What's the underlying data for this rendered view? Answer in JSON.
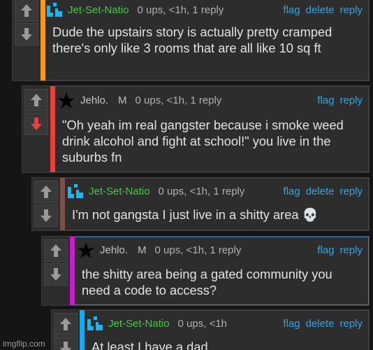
{
  "actions": {
    "flag": "flag",
    "delete": "delete",
    "reply": "reply"
  },
  "colors": {
    "orange": "#f39a1c",
    "red": "#e8403a",
    "brown": "#7e5148",
    "magenta": "#c41fc9",
    "blue": "#17a8f0"
  },
  "comments": [
    {
      "user": "Jet-Set-Natio",
      "meta": "0 ups, <1h, 1 reply",
      "text": "Dude the upstairs story is actually pretty cramped there's only like 3 rooms that are all like 10 sq ft"
    },
    {
      "user": "Jehlo.",
      "mod": "M",
      "meta": "0 ups, <1h, 1 reply",
      "text": "\"Oh yeah im real gangster because i smoke weed drink alcohol and fight at school!\" you live in the suburbs fn",
      "downvoted": true
    },
    {
      "user": "Jet-Set-Natio",
      "meta": "0 ups, <1h, 1 reply",
      "text": "I'm not gangsta I just live in a shitty area 💀"
    },
    {
      "user": "Jehlo.",
      "mod": "M",
      "meta": "0 ups, <1h, 1 reply",
      "text": "the shitty area being a gated community you need a code to access?"
    },
    {
      "user": "Jet-Set-Natio",
      "meta": "0 ups, <1h",
      "text": "At least I have a dad"
    }
  ],
  "watermark": "imgflip.com",
  "icons": {
    "upvote": "up-arrow-icon",
    "downvote": "down-arrow-icon",
    "avatar_green": "blue-pixel-avatar-icon",
    "avatar_star": "black-star-icon"
  }
}
